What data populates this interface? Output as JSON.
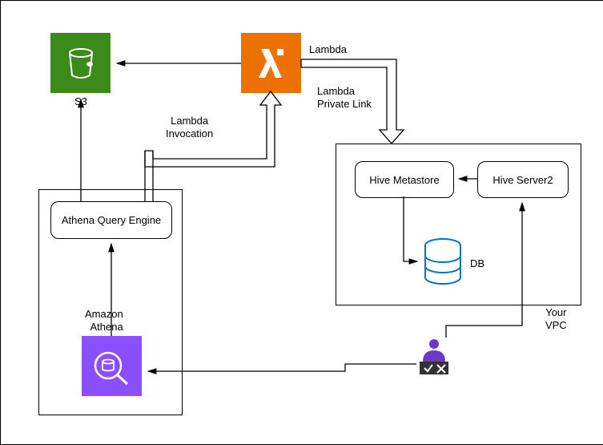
{
  "icons": {
    "s3": {
      "label": "S3"
    },
    "lambda": {
      "label": "Lambda"
    },
    "athena": {
      "label": "Amazon\nAthena"
    }
  },
  "boxes": {
    "athena_query_engine": "Athena Query Engine",
    "hive_metastore": "Hive Metastore",
    "hive_server2": "Hive Server2"
  },
  "labels": {
    "db": "DB",
    "your_vpc": "Your\nVPC",
    "lambda_invocation": "Lambda\nInvocation",
    "lambda_private_link": "Lambda\nPrivate Link"
  }
}
